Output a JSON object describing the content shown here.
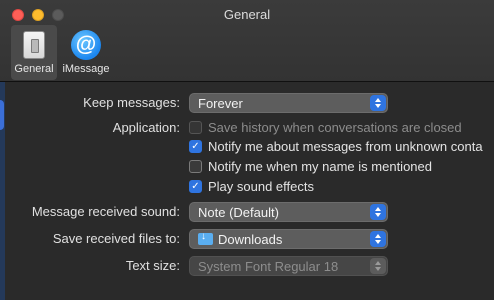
{
  "window": {
    "title": "General"
  },
  "toolbar": {
    "tabs": [
      {
        "label": "General",
        "icon": "switch-icon",
        "selected": true
      },
      {
        "label": "iMessage",
        "icon": "at-sign-icon",
        "selected": false
      }
    ]
  },
  "settings": {
    "keep_messages": {
      "label": "Keep messages:",
      "value": "Forever"
    },
    "application": {
      "label": "Application:",
      "options": [
        {
          "text": "Save history when conversations are closed",
          "checked": false,
          "enabled": false
        },
        {
          "text": "Notify me about messages from unknown conta",
          "checked": true,
          "enabled": true
        },
        {
          "text": "Notify me when my name is mentioned",
          "checked": false,
          "enabled": true
        },
        {
          "text": "Play sound effects",
          "checked": true,
          "enabled": true
        }
      ]
    },
    "message_sound": {
      "label": "Message received sound:",
      "value": "Note (Default)"
    },
    "save_files": {
      "label": "Save received files to:",
      "value": "Downloads",
      "icon": "downloads-folder-icon"
    },
    "text_size": {
      "label": "Text size:",
      "value": "System Font Regular 18",
      "enabled": false
    }
  },
  "colors": {
    "accent": "#2f74e0",
    "close": "#fe5f57",
    "minimize": "#febc2e"
  }
}
